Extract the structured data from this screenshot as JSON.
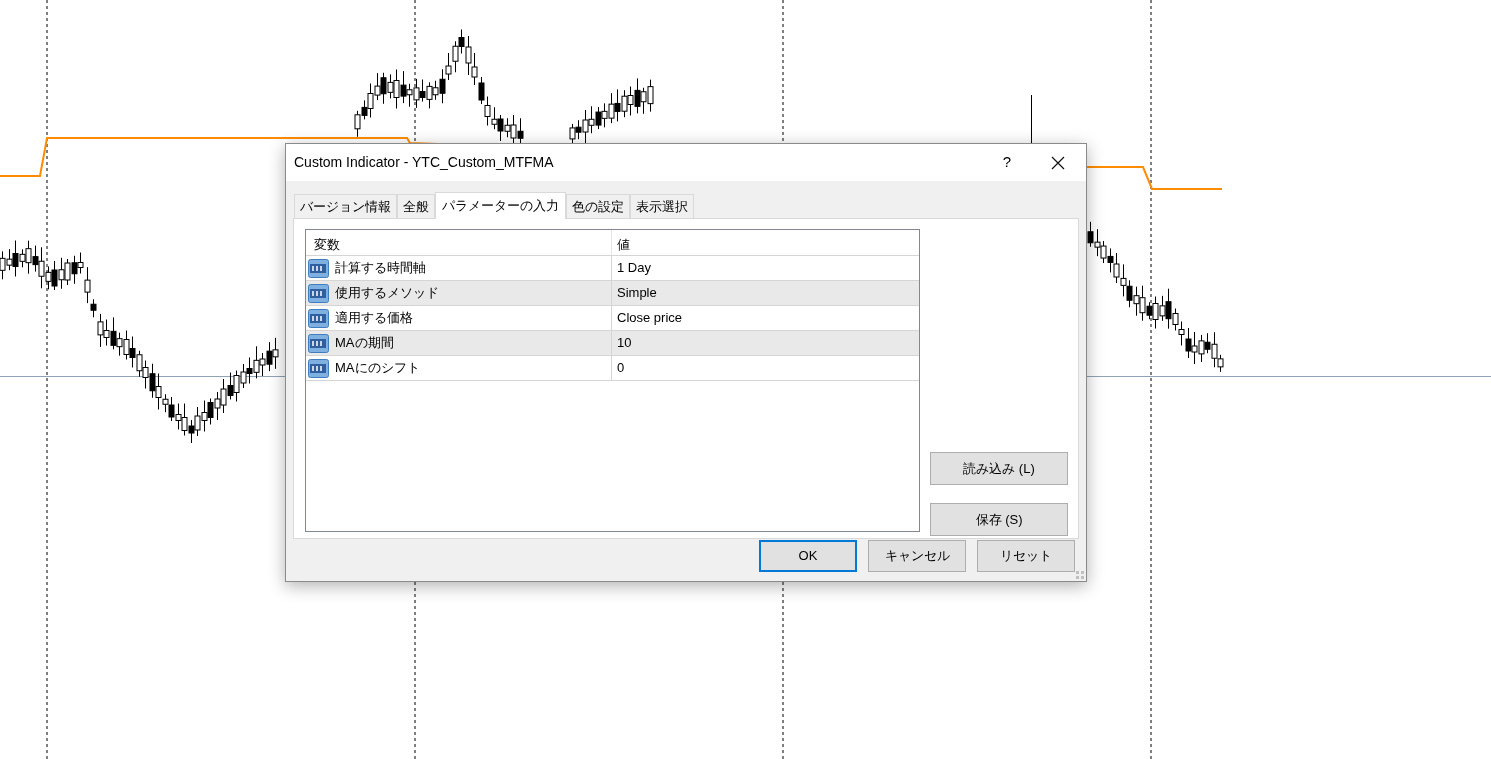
{
  "window": {
    "title": "Custom Indicator - YTC_Custom_MTFMA",
    "help": "?"
  },
  "tabs": [
    {
      "label": "バージョン情報",
      "selected": false
    },
    {
      "label": "全般",
      "selected": false
    },
    {
      "label": "パラメーターの入力",
      "selected": true
    },
    {
      "label": "色の設定",
      "selected": false
    },
    {
      "label": "表示選択",
      "selected": false
    }
  ],
  "table": {
    "columns": [
      "変数",
      "値"
    ],
    "rows": [
      {
        "name": "計算する時間軸",
        "value": "1 Day"
      },
      {
        "name": "使用するメソッド",
        "value": "Simple"
      },
      {
        "name": "適用する価格",
        "value": "Close price"
      },
      {
        "name": "MAの期間",
        "value": "10"
      },
      {
        "name": "MAにのシフト",
        "value": "0"
      }
    ]
  },
  "side_buttons": [
    "読み込み (L)",
    "保存 (S)"
  ],
  "buttons": [
    {
      "label": "OK",
      "default": true
    },
    {
      "label": "キャンセル",
      "default": false
    },
    {
      "label": "リセット",
      "default": false
    }
  ]
}
